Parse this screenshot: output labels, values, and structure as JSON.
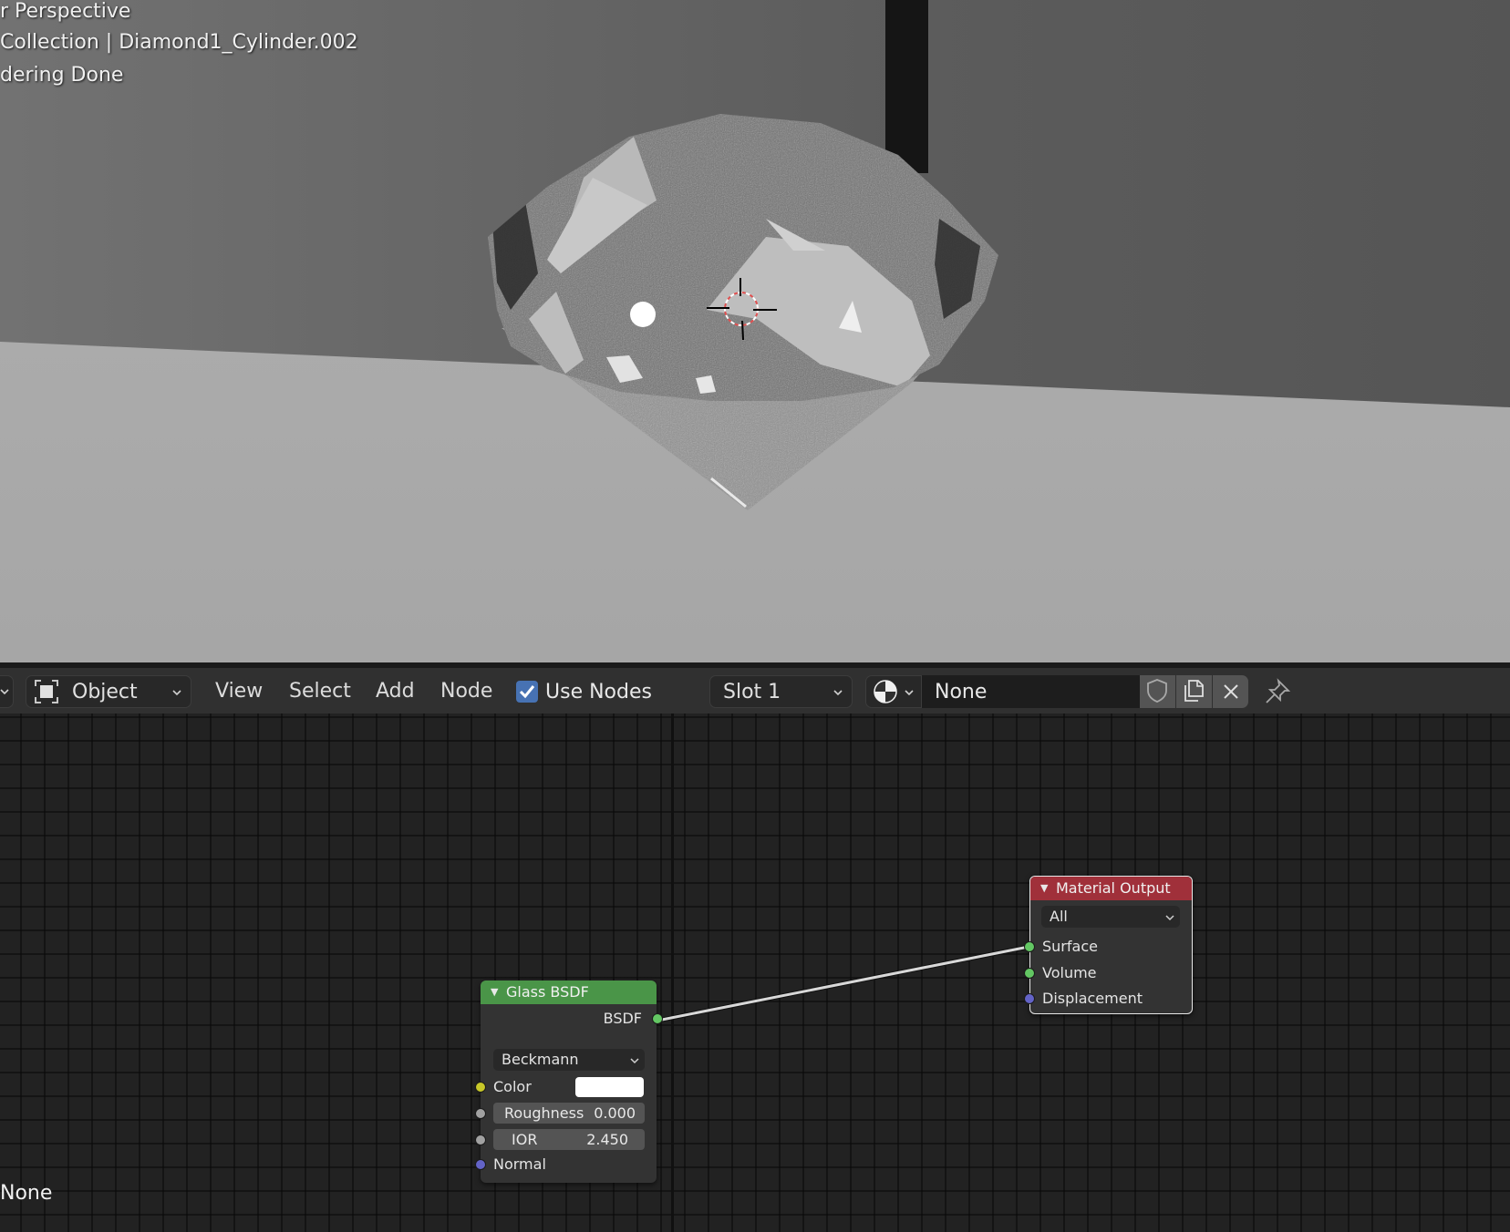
{
  "viewport": {
    "overlay": {
      "view_name": "r Perspective",
      "collection_object": "Collection | Diamond1_Cylinder.002",
      "render_status": "dering Done"
    }
  },
  "node_editor": {
    "header": {
      "editor_type_icon": "chevron-down-icon",
      "mode_select": {
        "icon": "object-mode-icon",
        "value": "Object"
      },
      "menus": [
        "View",
        "Select",
        "Add",
        "Node"
      ],
      "use_nodes": {
        "label": "Use Nodes",
        "checked": true
      },
      "slot_select": {
        "value": "Slot 1"
      },
      "material_browse_icon": "material-sphere-icon",
      "material_name": {
        "value": "None"
      },
      "fake_user_icon": "shield-icon",
      "new_material_icon": "duplicate-icon",
      "unlink_icon": "close-icon",
      "pin_icon": "pin-icon"
    },
    "nodes": {
      "glass_bsdf": {
        "title": "Glass BSDF",
        "header_color": "#4a9548",
        "output": "BSDF",
        "distribution": "Beckmann",
        "inputs": {
          "color": {
            "label": "Color",
            "value": "#ffffff"
          },
          "roughness": {
            "label": "Roughness",
            "value": "0.000"
          },
          "ior": {
            "label": "IOR",
            "value": "2.450"
          },
          "normal": {
            "label": "Normal"
          }
        }
      },
      "material_output": {
        "title": "Material Output",
        "header_color": "#a0303a",
        "target": "All",
        "inputs": [
          "Surface",
          "Volume",
          "Displacement"
        ]
      }
    },
    "links": [
      {
        "from": "Glass BSDF.BSDF",
        "to": "Material Output.Surface"
      }
    ],
    "socket_colors": {
      "shader": "#63c763",
      "color": "#c7c729",
      "float": "#a1a1a1",
      "vector": "#6363c7"
    },
    "footer_text": "None"
  }
}
